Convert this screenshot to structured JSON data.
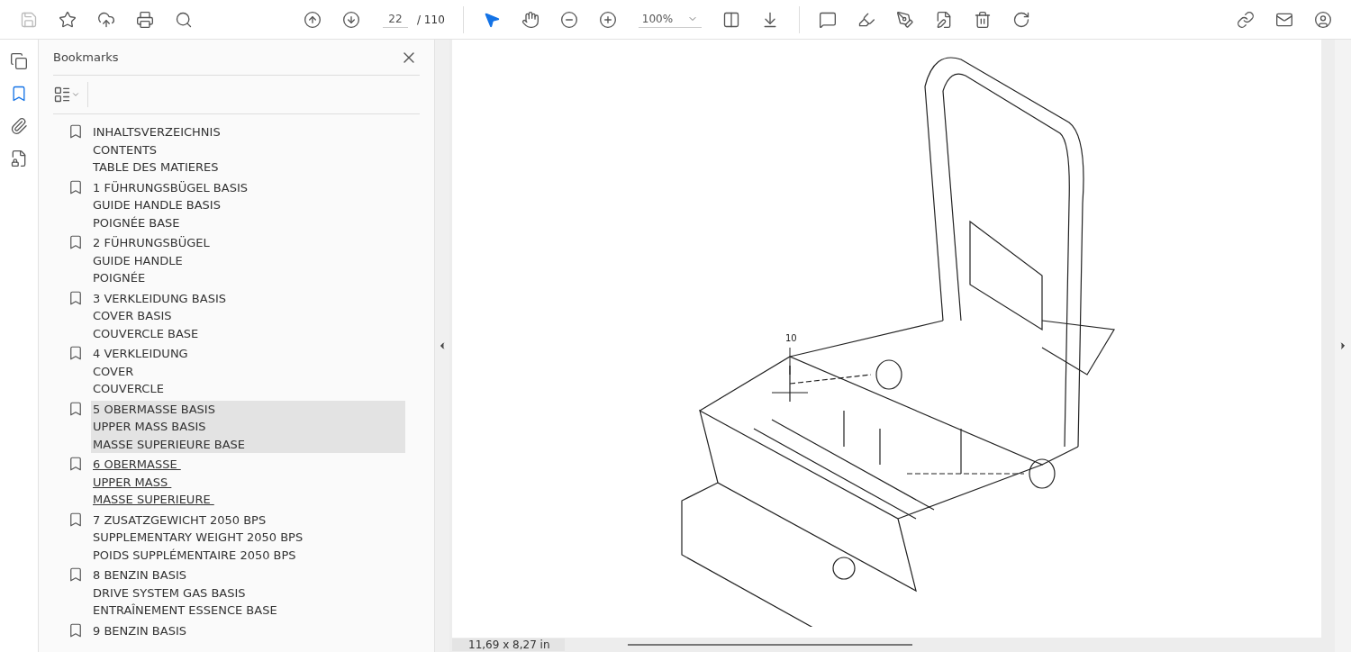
{
  "toolbar": {
    "page_current": "22",
    "page_total": "/ 110",
    "zoom": "100%"
  },
  "bookmarks_panel": {
    "title": "Bookmarks",
    "items": [
      {
        "lines": [
          "INHALTSVERZEICHNIS",
          "CONTENTS",
          "TABLE DES MATIERES"
        ],
        "selected": false,
        "hovered": false
      },
      {
        "lines": [
          "1 FÜHRUNGSBÜGEL BASIS",
          "GUIDE HANDLE BASIS",
          "POIGNÉE BASE"
        ],
        "selected": false,
        "hovered": false
      },
      {
        "lines": [
          "2 FÜHRUNGSBÜGEL",
          "GUIDE HANDLE",
          "POIGNÉE"
        ],
        "selected": false,
        "hovered": false
      },
      {
        "lines": [
          "3 VERKLEIDUNG BASIS",
          "COVER BASIS",
          "COUVERCLE BASE"
        ],
        "selected": false,
        "hovered": false
      },
      {
        "lines": [
          "4 VERKLEIDUNG",
          "COVER",
          "COUVERCLE"
        ],
        "selected": false,
        "hovered": false
      },
      {
        "lines": [
          "5 OBERMASSE BASIS",
          "UPPER MASS BASIS",
          "MASSE SUPERIEURE BASE"
        ],
        "selected": true,
        "hovered": false
      },
      {
        "lines": [
          "6 OBERMASSE ",
          "UPPER MASS ",
          "MASSE SUPERIEURE "
        ],
        "selected": false,
        "hovered": true
      },
      {
        "lines": [
          "7 ZUSATZGEWICHT 2050 BPS",
          "SUPPLEMENTARY WEIGHT 2050 BPS",
          "POIDS SUPPLÉMENTAIRE 2050 BPS"
        ],
        "selected": false,
        "hovered": false
      },
      {
        "lines": [
          "8 BENZIN BASIS",
          "DRIVE SYSTEM GAS BASIS",
          "ENTRAÎNEMENT ESSENCE BASE"
        ],
        "selected": false,
        "hovered": false
      },
      {
        "lines": [
          "9 BENZIN BASIS"
        ],
        "selected": false,
        "hovered": false
      }
    ]
  },
  "document": {
    "callout": "10",
    "page_size": "11,69 x 8,27 in"
  }
}
